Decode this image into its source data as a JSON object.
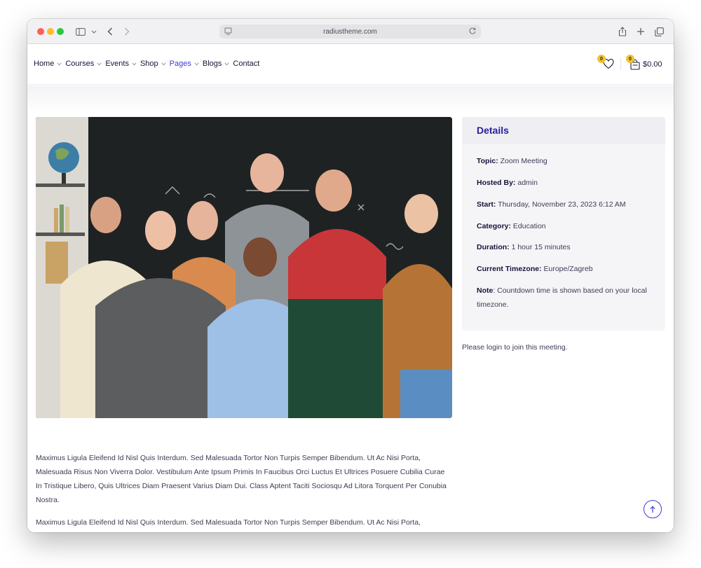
{
  "browser": {
    "url": "radiustheme.com"
  },
  "nav": {
    "items": [
      {
        "label": "Home",
        "has_dropdown": true,
        "active": false
      },
      {
        "label": "Courses",
        "has_dropdown": true,
        "active": false
      },
      {
        "label": "Events",
        "has_dropdown": true,
        "active": false
      },
      {
        "label": "Shop",
        "has_dropdown": true,
        "active": false
      },
      {
        "label": "Pages",
        "has_dropdown": true,
        "active": true
      },
      {
        "label": "Blogs",
        "has_dropdown": true,
        "active": false
      },
      {
        "label": "Contact",
        "has_dropdown": false,
        "active": false
      }
    ]
  },
  "header": {
    "wishlist_count": "0",
    "cart_count": "0",
    "cart_total": "$0.00"
  },
  "details": {
    "title": "Details",
    "rows": [
      {
        "label": "Topic:",
        "value": " Zoom Meeting"
      },
      {
        "label": "Hosted By:",
        "value": " admin"
      },
      {
        "label": "Start:",
        "value": " Thursday, November 23, 2023 6:12 AM"
      },
      {
        "label": "Category:",
        "value": " Education"
      },
      {
        "label": "Duration:",
        "value": " 1 hour 15 minutes"
      },
      {
        "label": "Current Timezone:",
        "value": " Europe/Zagreb"
      }
    ],
    "note_label": "Note",
    "note_text": ": Countdown time is shown based on your local timezone."
  },
  "login_note": "Please login to join this meeting.",
  "paragraphs": [
    "Maximus Ligula Eleifend Id Nisl Quis Interdum. Sed Malesuada Tortor Non Turpis Semper Bibendum. Ut Ac Nisi Porta, Malesuada Risus Non Viverra Dolor. Vestibulum Ante Ipsum Primis In Faucibus Orci Luctus Et Ultrices Posuere Cubilia Curae In Tristique Libero, Quis Ultrices Diam Praesent Varius Diam Dui. Class Aptent Taciti Sociosqu Ad Litora Torquent Per Conubia Nostra.",
    "Maximus Ligula Eleifend Id Nisl Quis Interdum. Sed Malesuada Tortor Non Turpis Semper Bibendum. Ut Ac Nisi Porta, Malesuada Risus Non Viverra Dolor. Vestibulum Ante Ipsum Primis In Faucibus Orci Luctus Et Ultrices Posuere Cubilia Curae In Tristique Libero, Quis Ultrices Diam Praesent Varius Diam Dui. Class Aptent Taciti Sociosqu Ad Litora Torquent"
  ],
  "colors": {
    "accent": "#3f3ad6",
    "details_title": "#241f9e",
    "badge": "#f2c230",
    "text": "#14143a"
  },
  "icons": [
    "sidebar-toggle-icon",
    "chevron-down-icon",
    "back-icon",
    "forward-icon",
    "page-icon",
    "reload-icon",
    "share-icon",
    "new-tab-icon",
    "tabs-overview-icon",
    "heart-icon",
    "cart-icon",
    "arrow-up-icon"
  ]
}
